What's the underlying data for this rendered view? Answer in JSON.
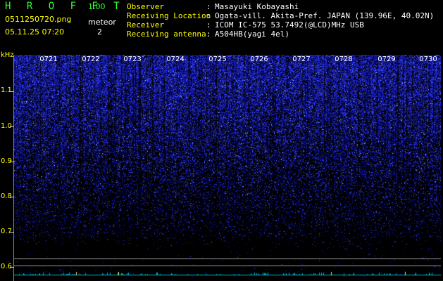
{
  "header": {
    "brand": "H R O F F T",
    "version": "1.00",
    "filename": "0511250720.png",
    "meteor_label": "meteor",
    "datetime": "05.11.25 07:20",
    "meteor_count": "2"
  },
  "info": [
    {
      "key": "Observer",
      "value": "Masayuki Kobayashi"
    },
    {
      "key": "Receiving Location",
      "value": "Ogata-vill. Akita-Pref. JAPAN (139.96E, 40.02N)"
    },
    {
      "key": "Receiver",
      "value": "ICOM IC-575 53.7492(@LCD)MHz USB"
    },
    {
      "key": "Receiving antenna",
      "value": "A504HB(yagi 4el)"
    }
  ],
  "spectrogram": {
    "freq_unit": "kHz",
    "freq_ticks": [
      "1.1",
      "1.0",
      "0.9",
      "0.8",
      "0.7",
      "0.6"
    ],
    "time_labels": [
      "0721",
      "0722",
      "0723",
      "0724",
      "0725",
      "0726",
      "0727",
      "0728",
      "0729",
      "0730"
    ],
    "colors": {
      "signal": "#4040ff",
      "bright": "#9fd0ff",
      "background": "#000000",
      "trace": "#00d8ff"
    }
  }
}
